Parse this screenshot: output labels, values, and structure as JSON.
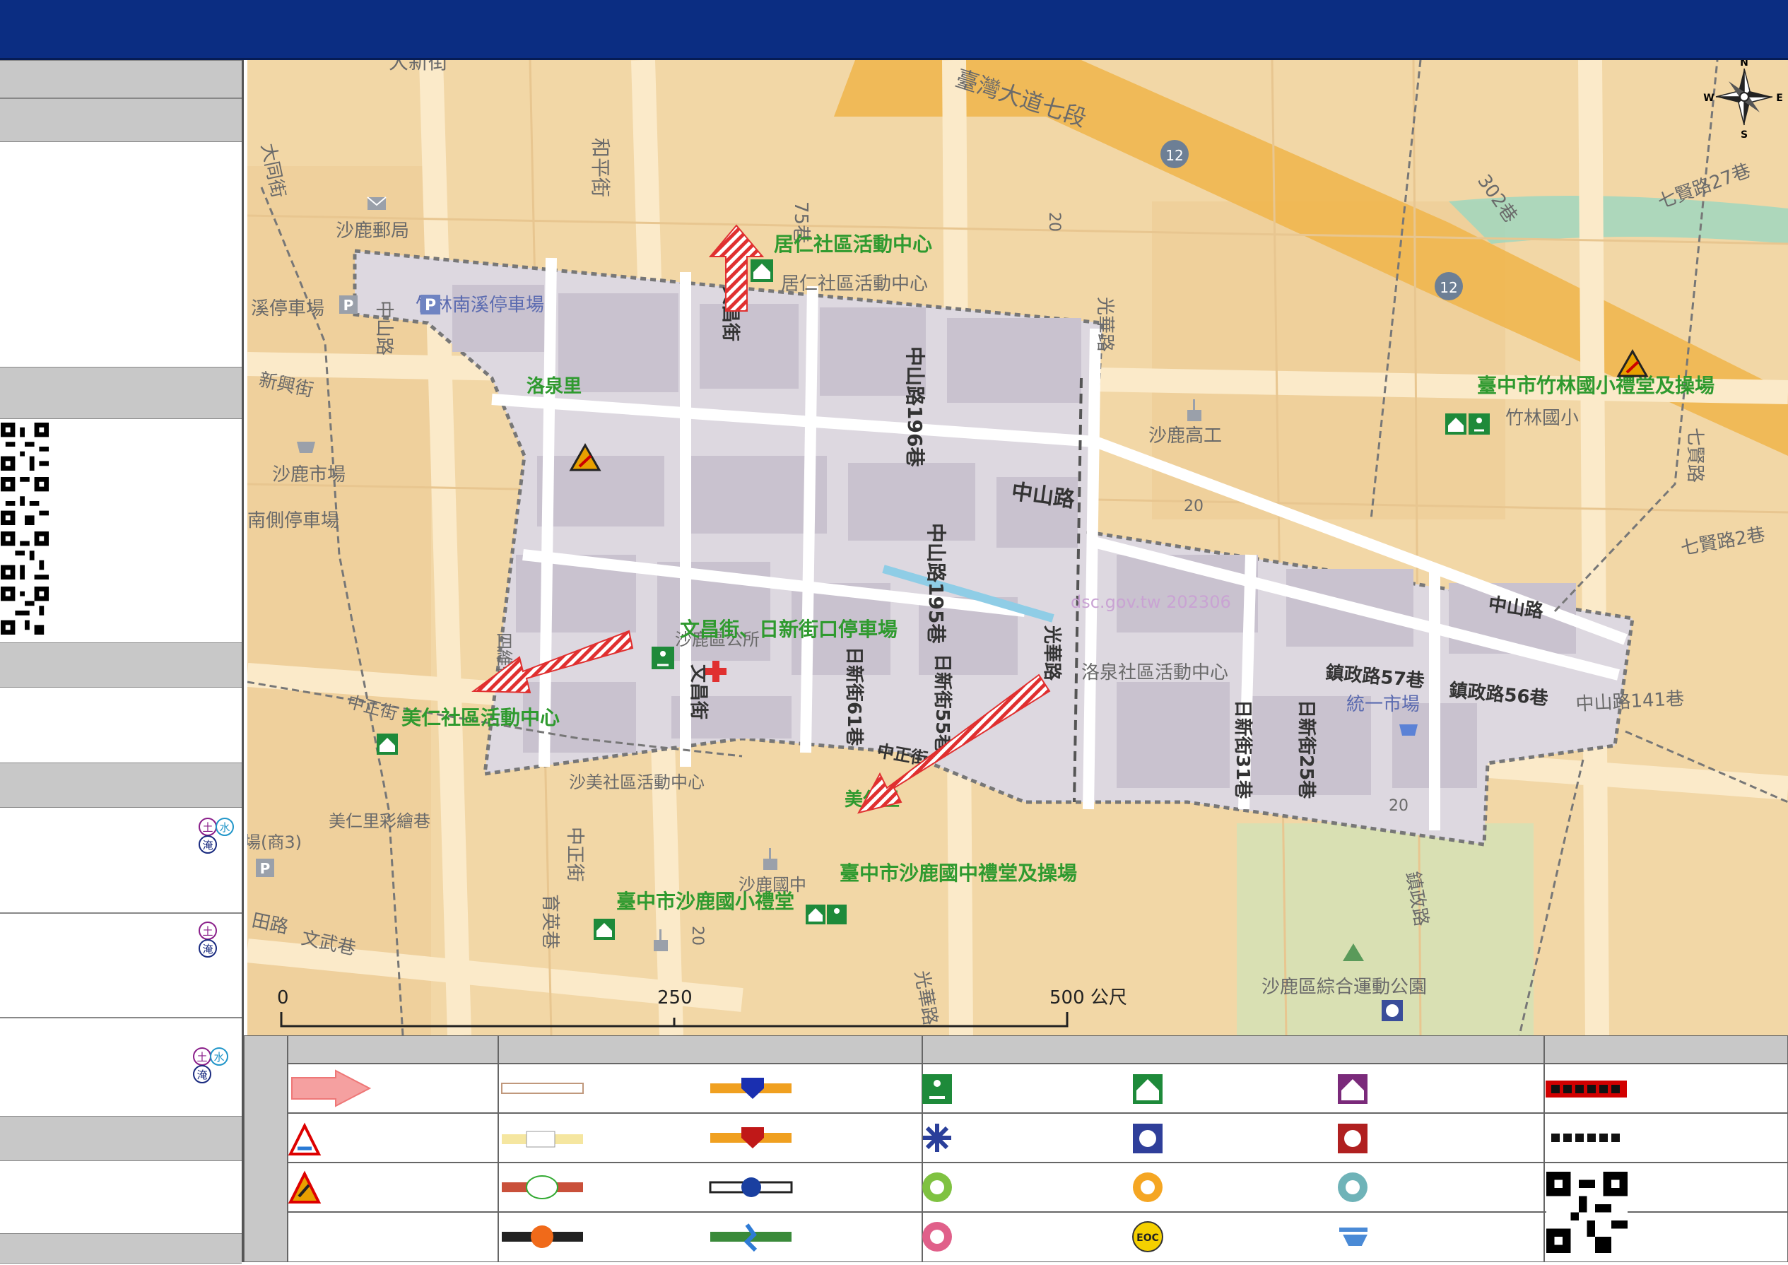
{
  "map": {
    "streets": {
      "daxin": "大新街",
      "taiwan_ave": "臺灣大道七段",
      "taiwan_ave_75": "75巷",
      "heping": "和平街",
      "datong": "大同街",
      "zhongshan_top": "中山路",
      "xinxing": "新興街",
      "wenchang_top": "文昌街",
      "zhongshan_196": "中山路196巷",
      "zhongshan_main": "中山路",
      "zhongshan_195": "中山路195巷",
      "guanghua_top": "光華路",
      "guanghua_mid": "光華路",
      "guanghua_bot": "光華路",
      "wenchang_mid": "文昌街",
      "rixin_61": "日新街61巷",
      "rixin_55": "日新街55巷",
      "rixin_31": "日新街31巷",
      "rixin_25": "日新街25巷",
      "zhenzheng_57": "鎮政路57巷",
      "zhenzheng_56": "鎮政路56巷",
      "zhongshan_141": "中山路141巷",
      "zhongshan_east": "中山路",
      "zhongzheng_w": "中正街",
      "zhongzheng_mid": "中正街",
      "zhongzheng_s": "中正街",
      "yuying": "育英巷",
      "tianlu": "田路",
      "wenwu": "文武巷",
      "zhenzheng_v": "鎮政路",
      "siwei": "四維街",
      "qixian_27": "七賢路27巷",
      "qixian_2": "七賢路2巷",
      "qixian": "七賢路",
      "lane_302": "302巷",
      "road_12": "12",
      "num_20a": "20",
      "num_20b": "20",
      "num_20c": "20",
      "num_20d": "20",
      "shang3": "場(商3)"
    },
    "places": {
      "post_office": "沙鹿郵局",
      "xilin_parking_w": "溪停車場",
      "zhulin_parking": "竹林南溪停車場",
      "luoquan_li": "洛泉里",
      "shalu_market": "沙鹿市場",
      "south_parking": "南側停車場",
      "township_office": "沙鹿區公所",
      "shalu_high": "沙鹿高工",
      "zhulin_elem": "竹林國小",
      "tongyi_market": "統一市場",
      "meiren_li": "美仁里",
      "meiren_art": "美仁里彩繪巷",
      "shamei_center": "沙美社區活動中心",
      "shalu_junior": "沙鹿國中",
      "sports_park": "沙鹿區綜合運動公園",
      "juren_center_gray": "居仁社區活動中心",
      "luoquan_center": "洛泉社區活動中心",
      "watermark": "dsc.gov.tw 202306"
    },
    "shelters": {
      "juren": "居仁社區活動中心",
      "zhulin_field": "臺中市竹林國小禮堂及操場",
      "wenchang_parking": "文昌街、日新街口停車場",
      "meiren_center": "美仁社區活動中心",
      "shalu_junior_field": "臺中市沙鹿國中禮堂及操場",
      "shalu_elem": "臺中市沙鹿國小禮堂"
    },
    "compass": {
      "n": "N",
      "s": "S",
      "e": "E",
      "w": "W"
    },
    "scale": {
      "zero": "0",
      "mid": "250",
      "end": "500 公尺"
    }
  },
  "sidebar": {
    "hazard_groups": [
      {
        "soil": "土",
        "water": "水",
        "flood": "淹"
      },
      {
        "soil": "土",
        "flood": "淹"
      },
      {
        "soil": "土",
        "water": "水",
        "flood": "淹"
      }
    ]
  },
  "colors": {
    "header": "#0b2d82",
    "map_bg": "#f2d7a6",
    "shelter_green": "#2f9a2f",
    "arrow_red": "#e03030",
    "block_gray": "#ddd8e0"
  },
  "icons": [
    "compass-rose-icon",
    "evacuation-arrow-icon",
    "shelter-icon",
    "evacuation-site-icon",
    "first-aid-icon",
    "parking-icon",
    "post-office-icon",
    "school-icon",
    "market-icon",
    "hazard-triangle-icon",
    "police-icon",
    "eoc-icon",
    "qr-code-icon"
  ]
}
